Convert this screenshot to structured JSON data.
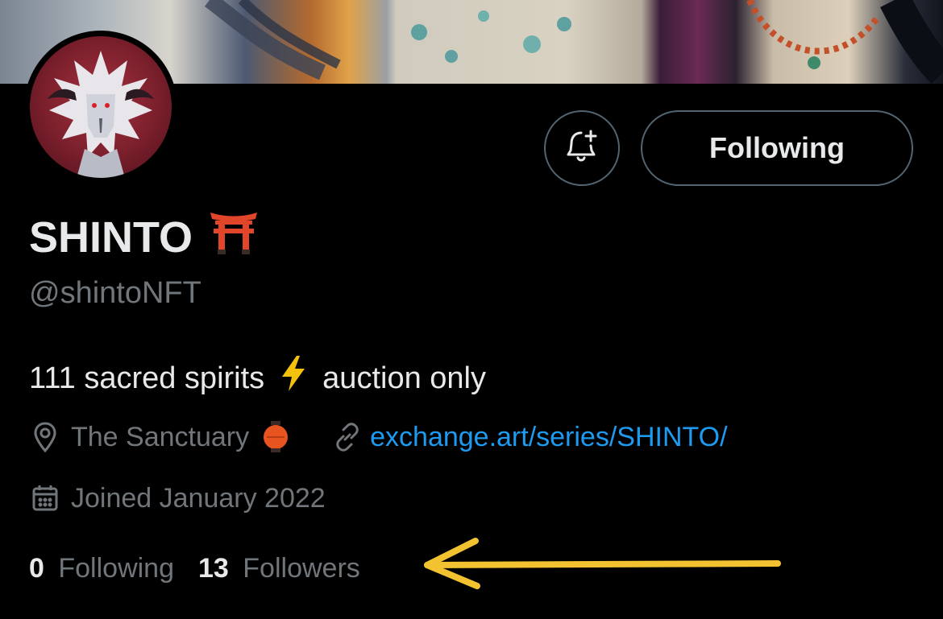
{
  "profile": {
    "display_name": "SHINTO",
    "name_emoji": "torii-gate-icon",
    "handle": "@shintoNFT",
    "bio_part1": "111 sacred spirits",
    "bio_part2": "auction only",
    "location": "The Sanctuary",
    "website": "exchange.art/series/SHINTO/",
    "joined": "Joined January 2022"
  },
  "actions": {
    "follow_label": "Following",
    "notify_icon": "bell-plus-icon"
  },
  "stats": {
    "following_count": "0",
    "following_label": "Following",
    "followers_count": "13",
    "followers_label": "Followers"
  },
  "colors": {
    "background": "#000000",
    "text": "#e7e9ea",
    "secondary": "#71767b",
    "link": "#1d9bf0",
    "border": "#536471",
    "annotation_arrow": "#f2c230"
  }
}
